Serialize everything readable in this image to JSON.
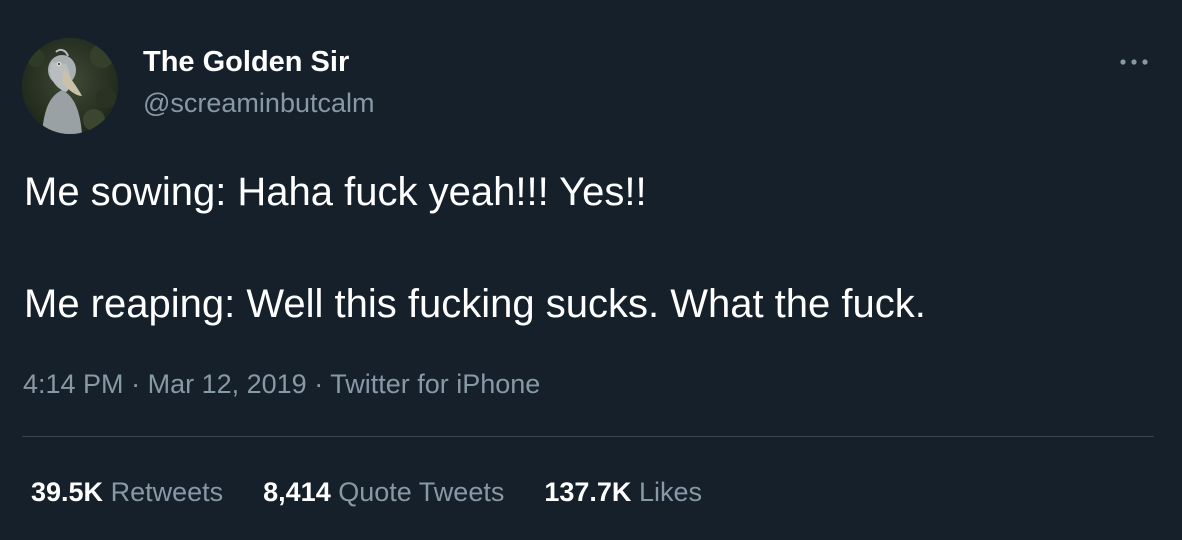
{
  "author": {
    "name": "The Golden Sir",
    "handle": "@screaminbutcalm"
  },
  "tweet": {
    "line_1": "Me sowing: Haha fuck yeah!!! Yes!!",
    "line_2": "Me reaping: Well this fucking sucks. What the fuck."
  },
  "meta": {
    "time": "4:14 PM",
    "separator": "·",
    "date": "Mar 12, 2019",
    "source": "Twitter for iPhone"
  },
  "stats": {
    "retweets": {
      "count": "39.5K",
      "label": "Retweets"
    },
    "quote_tweets": {
      "count": "8,414",
      "label": "Quote Tweets"
    },
    "likes": {
      "count": "137.7K",
      "label": "Likes"
    }
  },
  "icons": {
    "more": "more-horizontal-icon",
    "avatar": "shoebill-bird-photo"
  },
  "colors": {
    "background": "#15202b",
    "text_primary": "#ffffff",
    "text_secondary": "#8899a6",
    "divider": "#38444d"
  }
}
